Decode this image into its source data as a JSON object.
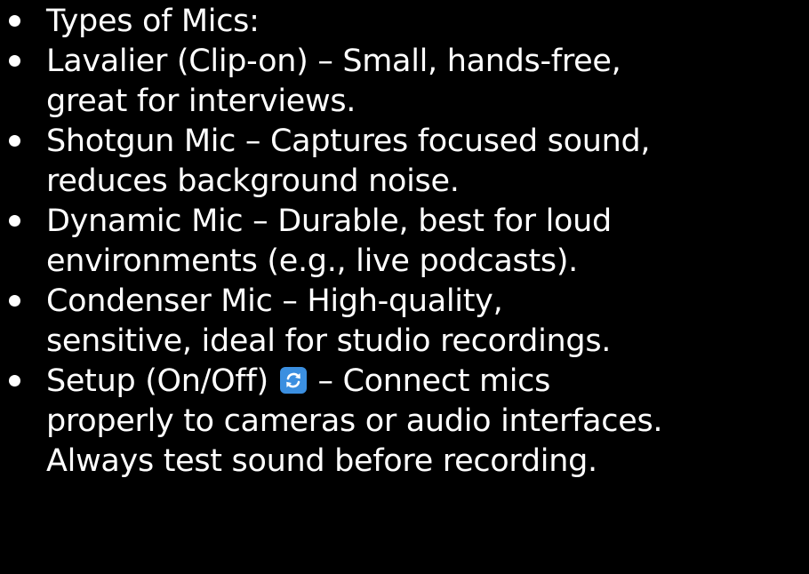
{
  "bullets": [
    {
      "lines": [
        "Types of Mics:"
      ]
    },
    {
      "lines": [
        "Lavalier (Clip-on) – Small, hands-free,",
        "great for interviews."
      ]
    },
    {
      "lines": [
        "Shotgun Mic – Captures focused sound,",
        "reduces background noise."
      ]
    },
    {
      "lines": [
        "Dynamic Mic – Durable, best for loud",
        "environments (e.g., live podcasts)."
      ]
    },
    {
      "lines": [
        "Condenser Mic – High-quality,",
        "sensitive, ideal for studio recordings."
      ]
    }
  ],
  "setup": {
    "before_icon": "Setup (On/Off)",
    "after_icon": " – Connect mics",
    "line2": "properly to cameras or audio interfaces.",
    "line3": "Always test sound before recording.",
    "icon": "refresh-icon",
    "icon_color": "#3b8fe0"
  },
  "colors": {
    "background": "#000000",
    "text": "#ffffff"
  }
}
